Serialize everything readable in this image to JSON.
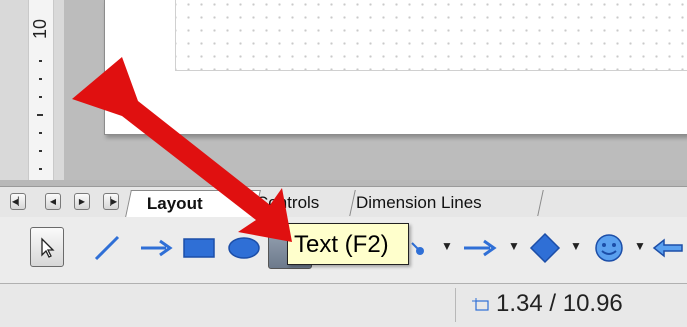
{
  "ruler": {
    "label": "10"
  },
  "tabs": {
    "nav": [
      "first-tab-icon",
      "previous-tab-icon",
      "next-tab-icon",
      "last-tab-icon"
    ],
    "items": [
      {
        "label": "Layout"
      },
      {
        "label": "Controls"
      },
      {
        "label": "Dimension Lines"
      }
    ]
  },
  "toolbar": {
    "tools": [
      "select-icon",
      "line-icon",
      "arrow-line-icon",
      "rectangle-icon",
      "ellipse-icon",
      "text-icon",
      "connector-icon",
      "block-arrows-icon",
      "flowchart-icon",
      "symbol-shapes-icon",
      "double-arrow-icon"
    ],
    "accent": "#2f6fd6"
  },
  "tooltip": {
    "text": "Text (F2)"
  },
  "statusbar": {
    "position": "1.34 / 10.96"
  },
  "annotation": {
    "arrow_color": "#e01010"
  }
}
